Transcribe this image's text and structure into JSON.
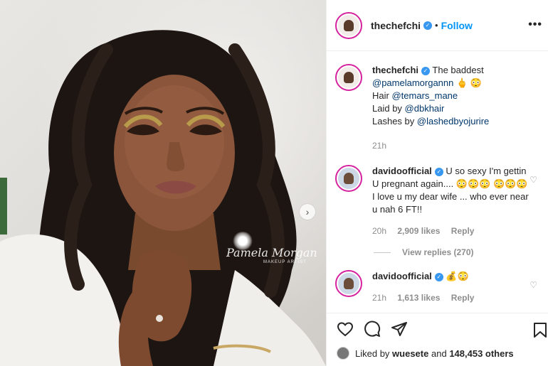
{
  "post": {
    "username": "thechefchi",
    "follow_label": "Follow",
    "separator": "•",
    "more_label": "•••",
    "watermark": "Pamela Morgan",
    "watermark_sub": "MAKEUP ARTIST",
    "next_arrow": "›"
  },
  "caption": {
    "username": "thechefchi",
    "text_1": "The baddest",
    "mention_1": "@pamelamorgannn",
    "emoji_1": "🖕 😳",
    "hair_label": "Hair",
    "mention_hair": "@temars_mane",
    "laid_label": "Laid by",
    "mention_laid": "@dbkhair",
    "lashes_label": "Lashes by",
    "mention_lashes": "@lashedbyojurire",
    "time": "21h"
  },
  "comments": [
    {
      "username": "davidoofficial",
      "text": "U so sexy I'm gettin U pregnant again.... 😳😳😳 😳😳😳 I love u my dear wife ... who ever near u nah 6 FT!!",
      "time": "20h",
      "likes": "2,909 likes",
      "reply_label": "Reply",
      "view_replies": "View replies (270)"
    },
    {
      "username": "davidoofficial",
      "text": "💰😳",
      "time": "21h",
      "likes": "1,613 likes",
      "reply_label": "Reply"
    }
  ],
  "likes_summary": {
    "prefix": "Liked by",
    "user": "wuesete",
    "middle": "and",
    "count": "148,453 others"
  },
  "icons": [
    "heart-icon",
    "comment-icon",
    "share-icon",
    "bookmark-icon",
    "verified-icon"
  ],
  "colors": {
    "accent": "#0095f6",
    "verified": "#3897f0",
    "muted": "#8e8e8e"
  }
}
